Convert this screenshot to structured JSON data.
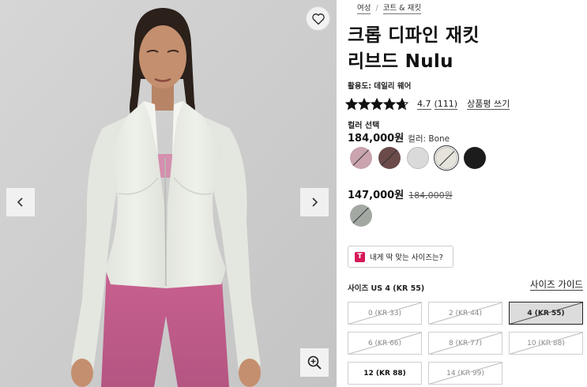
{
  "gallery": {
    "favorite_icon": "heart-icon",
    "prev_icon": "chevron-left-icon",
    "next_icon": "chevron-right-icon",
    "zoom_icon": "zoom-in-icon"
  },
  "breadcrumb": {
    "items": [
      "여성",
      "코트 & 재킷"
    ]
  },
  "product": {
    "title_line1": "크롭 디파인 재킷",
    "title_line2": "리브드 Nulu",
    "activity": "활용도: 데일리 웨어",
    "rating": "4.7",
    "rating_count": "(111)",
    "rating_stars": 4.7,
    "write_review": "상품평 쓰기"
  },
  "color": {
    "heading": "컬러 선택",
    "price": "184,000원",
    "selected_label": "컬러: Bone",
    "swatches": [
      {
        "color": "#c9a3ad",
        "unavailable": true
      },
      {
        "color": "#6b4a4a",
        "unavailable": true
      },
      {
        "color": "#dadada",
        "unavailable": false
      },
      {
        "color": "#e6e4da",
        "unavailable": true,
        "selected": true
      },
      {
        "color": "#1c1c1c",
        "unavailable": false
      }
    ]
  },
  "sale": {
    "price": "147,000원",
    "original_price": "184,000원",
    "swatch_color": "#a3a8a3"
  },
  "size_finder": {
    "label": "내게 딱 맞는 사이즈는?",
    "logo": "T"
  },
  "sizes": {
    "heading": "사이즈 US 4 (KR 55)",
    "guide": "사이즈 가이드",
    "options": [
      {
        "label": "0 (KR 33)",
        "state": "unavailable"
      },
      {
        "label": "2 (KR 44)",
        "state": "unavailable"
      },
      {
        "label": "4 (KR 55)",
        "state": "selected"
      },
      {
        "label": "6 (KR 66)",
        "state": "unavailable"
      },
      {
        "label": "8 (KR 77)",
        "state": "unavailable"
      },
      {
        "label": "10 (KR 88)",
        "state": "unavailable"
      },
      {
        "label": "12 (KR 88)",
        "state": "available"
      },
      {
        "label": "14 (KR 99)",
        "state": "unavailable"
      }
    ]
  }
}
